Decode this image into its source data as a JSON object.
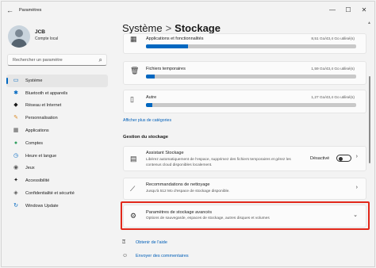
{
  "window": {
    "title": "Paramètres",
    "controls": [
      "—",
      "☐",
      "✕"
    ]
  },
  "profile": {
    "name": "JCB",
    "subtitle": "Compte local"
  },
  "search": {
    "placeholder": "Rechercher un paramètre"
  },
  "sidebar": {
    "items": [
      {
        "label": "Système",
        "icon": "system-icon",
        "color": "#0067c0",
        "active": true
      },
      {
        "label": "Bluetooth et appareils",
        "icon": "bluetooth-icon",
        "color": "#0067c0"
      },
      {
        "label": "Réseau et Internet",
        "icon": "network-icon",
        "color": "#1a1a1a"
      },
      {
        "label": "Personnalisation",
        "icon": "brush-icon",
        "color": "#d98a26"
      },
      {
        "label": "Applications",
        "icon": "apps-icon",
        "color": "#555555"
      },
      {
        "label": "Comptes",
        "icon": "accounts-icon",
        "color": "#2f9e5f"
      },
      {
        "label": "Heure et langue",
        "icon": "clock-language-icon",
        "color": "#0067c0"
      },
      {
        "label": "Jeux",
        "icon": "gamepad-icon",
        "color": "#555555"
      },
      {
        "label": "Accessibilité",
        "icon": "accessibility-icon",
        "color": "#1a1a1a"
      },
      {
        "label": "Confidentialité et sécurité",
        "icon": "shield-icon",
        "color": "#555555"
      },
      {
        "label": "Windows Update",
        "icon": "update-icon",
        "color": "#0067c0"
      }
    ]
  },
  "breadcrumb": {
    "parent": "Système",
    "separator": ">",
    "current": "Stockage"
  },
  "storage_categories": [
    {
      "name": "Applications et fonctionnalités",
      "size": "8,51 Go/43,4 Go utilisé(s)",
      "fraction": 0.2,
      "icon": "apps-icon"
    },
    {
      "name": "Fichiers temporaires",
      "size": "1,59 Go/43,4 Go utilisé(s)",
      "fraction": 0.04,
      "icon": "trash-icon"
    },
    {
      "name": "Autre",
      "size": "1,27 Go/43,4 Go utilisé(s)",
      "fraction": 0.03,
      "icon": "document-icon"
    }
  ],
  "show_more_link": "Afficher plus de catégories",
  "management": {
    "title": "Gestion du stockage",
    "assistant": {
      "title": "Assistant Stockage",
      "description": "Libérez automatiquement de l'espace, supprimez des fichiers temporaires et gérez les contenus cloud disponibles localement.",
      "toggle_label": "Désactivé",
      "toggle_on": false
    },
    "cleanup": {
      "title": "Recommandations de nettoyage",
      "description": "Jusqu'à 512 Mo d'espace de stockage disponible."
    },
    "advanced": {
      "title": "Paramètres de stockage avancés",
      "description": "Options de sauvegarde, espaces de stockage, autres disques et volumes"
    }
  },
  "help": {
    "get_help": "Obtenir de l'aide",
    "feedback": "Envoyer des commentaires"
  },
  "colors": {
    "accent": "#0067c0",
    "highlight": "#e2281b"
  }
}
